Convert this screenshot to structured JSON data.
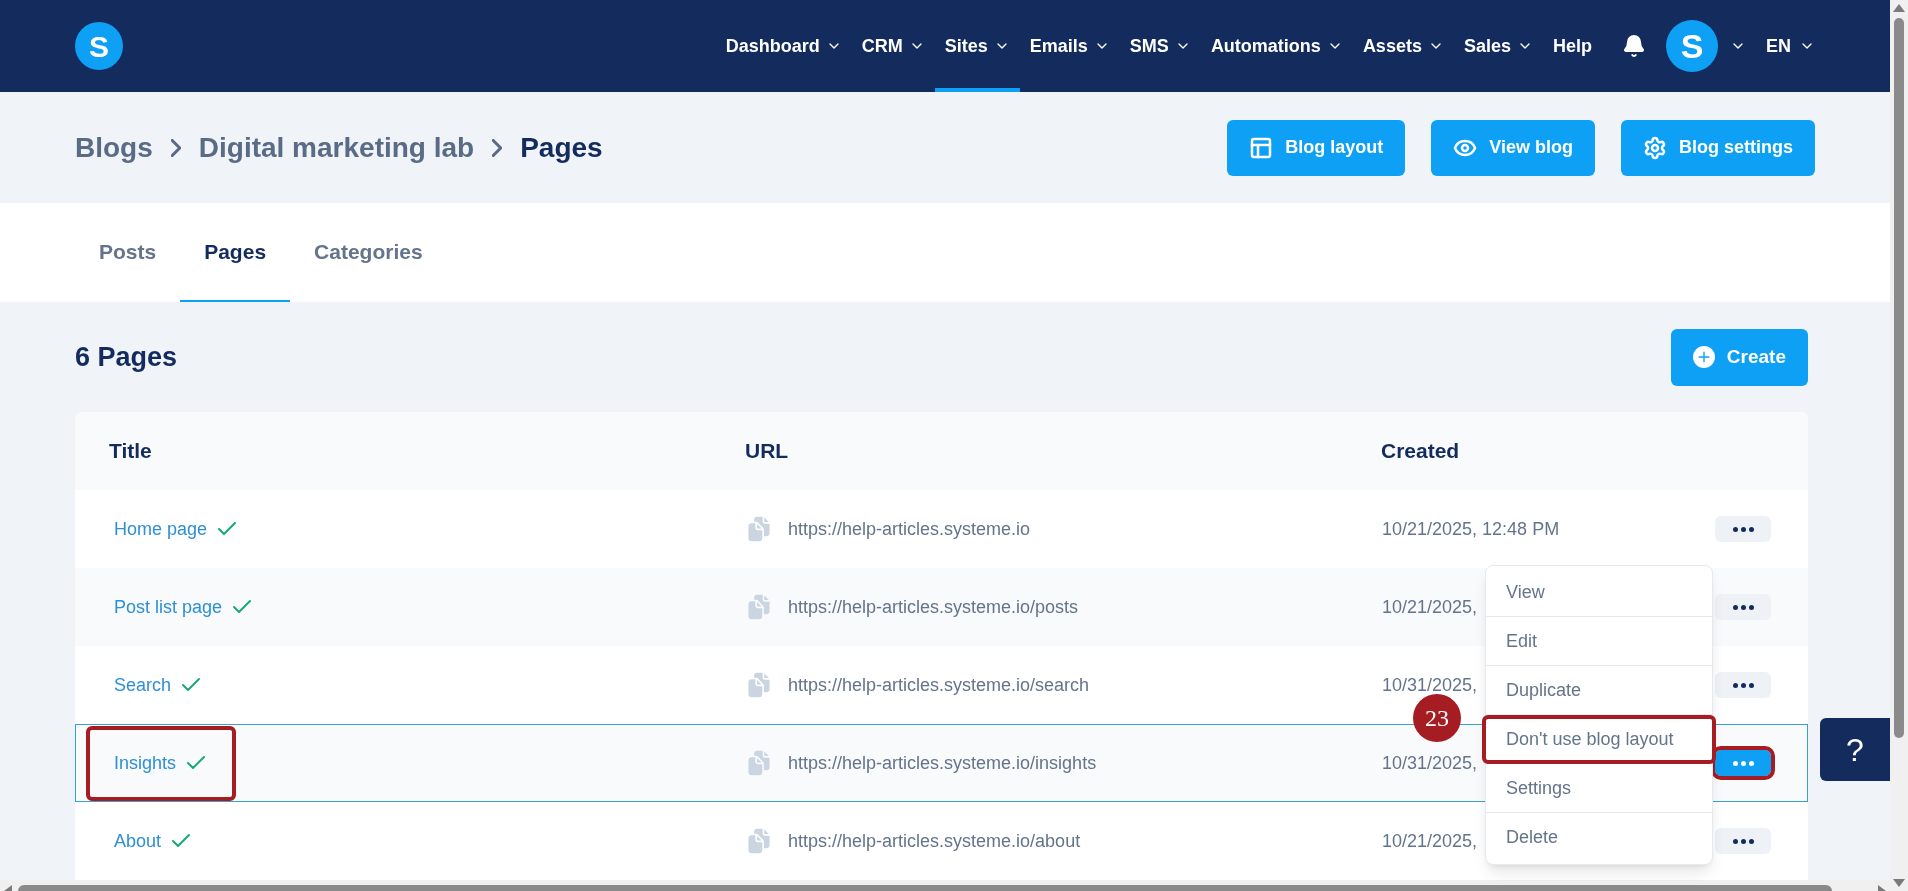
{
  "logo": "S",
  "nav": {
    "items": [
      {
        "label": "Dashboard",
        "dropdown": true,
        "selected": false
      },
      {
        "label": "CRM",
        "dropdown": true,
        "selected": false
      },
      {
        "label": "Sites",
        "dropdown": true,
        "selected": true
      },
      {
        "label": "Emails",
        "dropdown": true,
        "selected": false
      },
      {
        "label": "SMS",
        "dropdown": true,
        "selected": false
      },
      {
        "label": "Automations",
        "dropdown": true,
        "selected": false
      },
      {
        "label": "Assets",
        "dropdown": true,
        "selected": false
      },
      {
        "label": "Sales",
        "dropdown": true,
        "selected": false
      },
      {
        "label": "Help",
        "dropdown": false,
        "selected": false
      }
    ],
    "avatar": "S",
    "language": "EN"
  },
  "breadcrumb": [
    "Blogs",
    "Digital marketing lab",
    "Pages"
  ],
  "header_buttons": [
    {
      "label": "Blog layout",
      "kind": "layout"
    },
    {
      "label": "View blog",
      "kind": "view"
    },
    {
      "label": "Blog settings",
      "kind": "settings"
    }
  ],
  "tabs": [
    {
      "label": "Posts",
      "selected": false
    },
    {
      "label": "Pages",
      "selected": true
    },
    {
      "label": "Categories",
      "selected": false
    }
  ],
  "heading": "6 Pages",
  "create_button": "Create",
  "table": {
    "columns": [
      "Title",
      "URL",
      "Created"
    ],
    "rows": [
      {
        "title": "Home page",
        "published": true,
        "url": "https://help-articles.systeme.io",
        "created": "10/21/2025, 12:48 PM",
        "selected": false,
        "highlighted": false
      },
      {
        "title": "Post list page",
        "published": true,
        "url": "https://help-articles.systeme.io/posts",
        "created": "10/21/2025,",
        "selected": false,
        "highlighted": false
      },
      {
        "title": "Search",
        "published": true,
        "url": "https://help-articles.systeme.io/search",
        "created": "10/31/2025,",
        "selected": false,
        "highlighted": false
      },
      {
        "title": "Insights",
        "published": true,
        "url": "https://help-articles.systeme.io/insights",
        "created": "10/31/2025,",
        "selected": true,
        "highlighted": true
      },
      {
        "title": "About",
        "published": true,
        "url": "https://help-articles.systeme.io/about",
        "created": "10/21/2025,",
        "selected": false,
        "highlighted": false
      }
    ]
  },
  "menu": {
    "items": [
      {
        "label": "View",
        "highlighted": false
      },
      {
        "label": "Edit",
        "highlighted": false
      },
      {
        "label": "Duplicate",
        "highlighted": false
      },
      {
        "label": "Don't use blog layout",
        "highlighted": true
      },
      {
        "label": "Settings",
        "highlighted": false
      },
      {
        "label": "Delete",
        "highlighted": false
      }
    ]
  },
  "step_badge": "23",
  "help_button": "?"
}
